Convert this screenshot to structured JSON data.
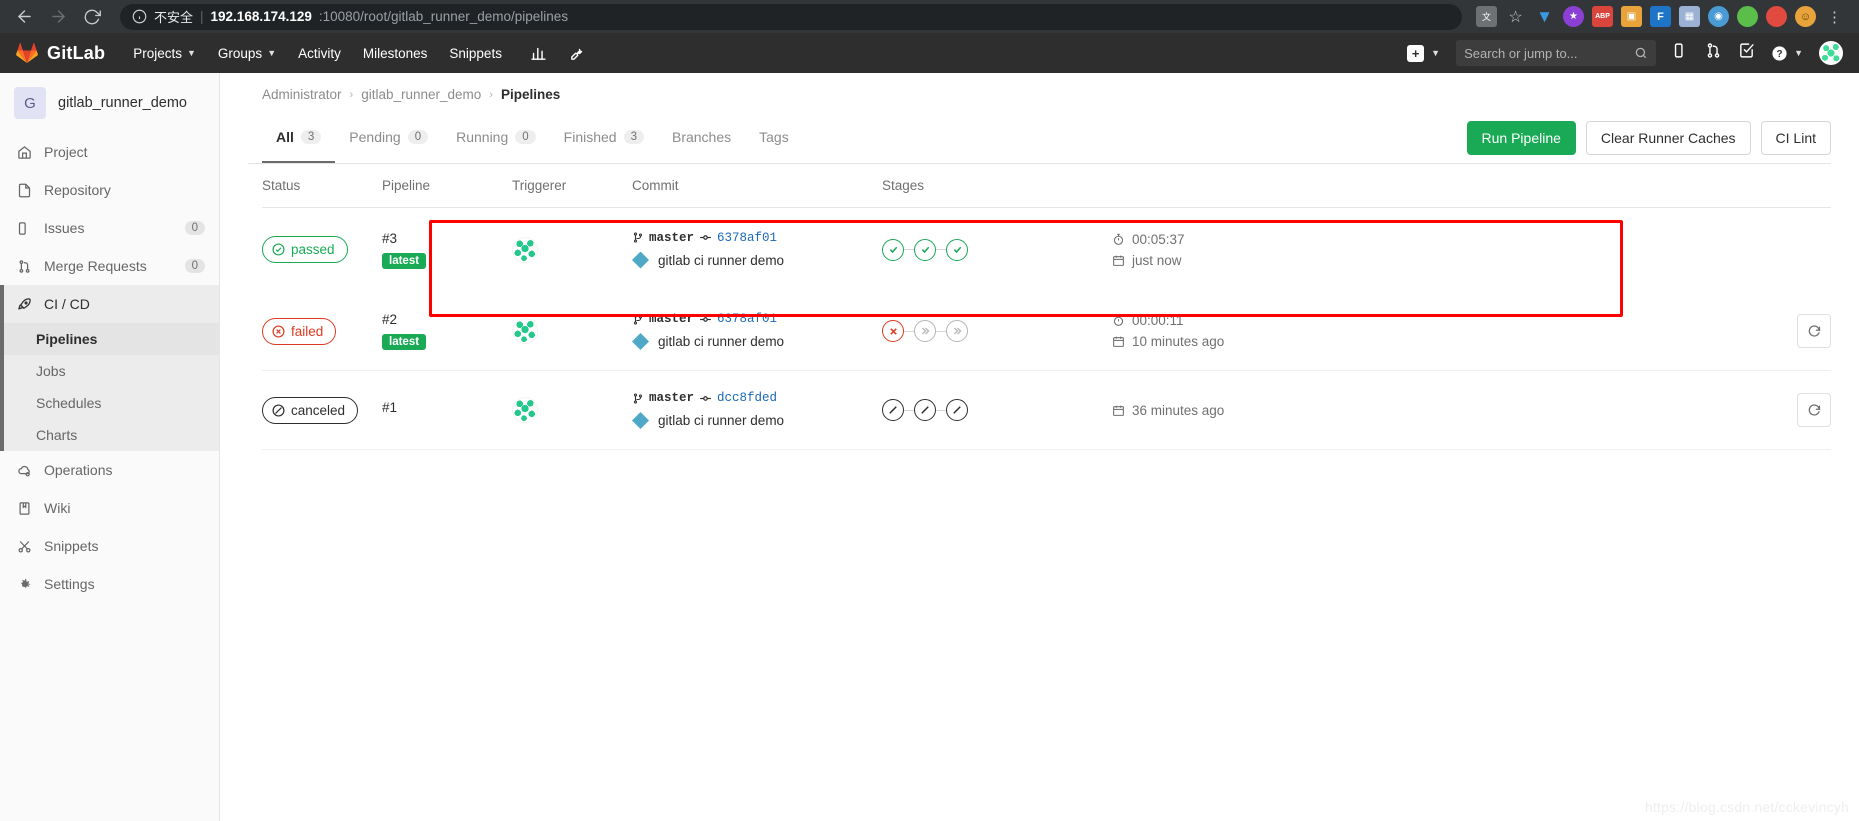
{
  "browser": {
    "back_icon": "back-arrow-icon",
    "forward_icon": "forward-arrow-icon",
    "reload_icon": "reload-icon",
    "security_label": "不安全",
    "url_host": "192.168.174.129",
    "url_rest": ":10080/root/gitlab_runner_demo/pipelines",
    "url_full": "192.168.174.129:10080/root/gitlab_runner_demo/pipelines",
    "toolbar_icons": [
      {
        "name": "translate-icon",
        "glyph": "文",
        "color": "#7a7d80"
      },
      {
        "name": "bookmark-star-icon",
        "glyph": "☆",
        "color": "transparent"
      },
      {
        "name": "shield-extension-icon",
        "glyph": "◆",
        "color": "#2a7fd4"
      },
      {
        "name": "purple-circle-extension-icon",
        "glyph": "★",
        "color": "#8b3fd4"
      },
      {
        "name": "adblock-icon",
        "glyph": "ABP",
        "color": "#d9453d"
      },
      {
        "name": "orange-extension-icon",
        "glyph": "▣",
        "color": "#e8743b"
      },
      {
        "name": "blue-extension-icon",
        "glyph": "F",
        "color": "#1e74c6"
      },
      {
        "name": "grid-extension-icon",
        "glyph": "▦",
        "color": "#9bb2d4"
      },
      {
        "name": "globe-extension-icon",
        "glyph": "◉",
        "color": "#4a9ad4"
      },
      {
        "name": "green-extension-icon",
        "glyph": "●",
        "color": "#5bbd4a"
      },
      {
        "name": "red-extension-icon",
        "glyph": "●",
        "color": "#e04a3f"
      },
      {
        "name": "smiley-extension-icon",
        "glyph": "☺",
        "color": "#e8a33b"
      },
      {
        "name": "menu-icon",
        "glyph": "⋮",
        "color": "transparent"
      }
    ]
  },
  "topnav": {
    "brand": "GitLab",
    "menu": [
      {
        "label": "Projects",
        "has_caret": true
      },
      {
        "label": "Groups",
        "has_caret": true
      },
      {
        "label": "Activity",
        "has_caret": false
      },
      {
        "label": "Milestones",
        "has_caret": false
      },
      {
        "label": "Snippets",
        "has_caret": false
      }
    ],
    "right_icons": [
      {
        "name": "analytics-icon",
        "glyph": "▥"
      },
      {
        "name": "wrench-admin-icon",
        "glyph": "🔧"
      }
    ],
    "new_label": "+",
    "search_placeholder": "Search or jump to...",
    "actions": [
      {
        "name": "issues-icon",
        "glyph": "▯"
      },
      {
        "name": "merge-requests-icon",
        "glyph": "⑂"
      },
      {
        "name": "todos-icon",
        "glyph": "☑"
      },
      {
        "name": "help-icon",
        "glyph": "?"
      }
    ]
  },
  "sidebar": {
    "project_initial": "G",
    "project_name": "gitlab_runner_demo",
    "items": [
      {
        "label": "Project",
        "icon": "home-icon",
        "badge": null,
        "active": false
      },
      {
        "label": "Repository",
        "icon": "document-icon",
        "badge": null,
        "active": false
      },
      {
        "label": "Issues",
        "icon": "issues-icon",
        "badge": "0",
        "active": false
      },
      {
        "label": "Merge Requests",
        "icon": "merge-request-icon",
        "badge": "0",
        "active": false
      },
      {
        "label": "CI / CD",
        "icon": "rocket-icon",
        "badge": null,
        "active": true
      },
      {
        "label": "Operations",
        "icon": "cloud-gear-icon",
        "badge": null,
        "active": false
      },
      {
        "label": "Wiki",
        "icon": "book-icon",
        "badge": null,
        "active": false
      },
      {
        "label": "Snippets",
        "icon": "scissors-icon",
        "badge": null,
        "active": false
      },
      {
        "label": "Settings",
        "icon": "gear-icon",
        "badge": null,
        "active": false
      }
    ],
    "cicd_subitems": [
      {
        "label": "Pipelines",
        "current": true
      },
      {
        "label": "Jobs",
        "current": false
      },
      {
        "label": "Schedules",
        "current": false
      },
      {
        "label": "Charts",
        "current": false
      }
    ]
  },
  "breadcrumb": {
    "items": [
      "Administrator",
      "gitlab_runner_demo",
      "Pipelines"
    ],
    "separator": "›"
  },
  "tabs": [
    {
      "label": "All",
      "count": "3",
      "active": true
    },
    {
      "label": "Pending",
      "count": "0",
      "active": false
    },
    {
      "label": "Running",
      "count": "0",
      "active": false
    },
    {
      "label": "Finished",
      "count": "3",
      "active": false
    },
    {
      "label": "Branches",
      "count": null,
      "active": false
    },
    {
      "label": "Tags",
      "count": null,
      "active": false
    }
  ],
  "actions": {
    "run_pipeline": "Run Pipeline",
    "clear_runner_caches": "Clear Runner Caches",
    "ci_lint": "CI Lint"
  },
  "table": {
    "headers": [
      "Status",
      "Pipeline",
      "Triggerer",
      "Commit",
      "Stages"
    ],
    "rows": [
      {
        "status": "passed",
        "status_kind": "passed",
        "status_icon": "check-circle-icon",
        "pipeline_id": "#3",
        "latest_badge": "latest",
        "triggerer_avatar": "user-avatar",
        "branch": "master",
        "sha": "6378af01",
        "commit_title": "gitlab ci runner demo",
        "stages": [
          "success",
          "success",
          "success"
        ],
        "duration": "00:05:37",
        "finished": "just now",
        "retry": false,
        "highlighted": true
      },
      {
        "status": "failed",
        "status_kind": "failed",
        "status_icon": "x-circle-icon",
        "pipeline_id": "#2",
        "latest_badge": "latest",
        "triggerer_avatar": "user-avatar",
        "branch": "master",
        "sha": "6378af01",
        "commit_title": "gitlab ci runner demo",
        "stages": [
          "fail",
          "skipped",
          "skipped"
        ],
        "duration": "00:00:11",
        "finished": "10 minutes ago",
        "retry": true,
        "highlighted": false
      },
      {
        "status": "canceled",
        "status_kind": "canceled",
        "status_icon": "cancel-circle-icon",
        "pipeline_id": "#1",
        "latest_badge": null,
        "triggerer_avatar": "user-avatar",
        "branch": "master",
        "sha": "dcc8fded",
        "commit_title": "gitlab ci runner demo",
        "stages": [
          "cancel",
          "cancel",
          "cancel"
        ],
        "duration": null,
        "finished": "36 minutes ago",
        "retry": true,
        "highlighted": false
      }
    ],
    "retry_icon": "retry-icon",
    "duration_icon": "stopwatch-icon",
    "date_icon": "calendar-icon"
  },
  "colors": {
    "accent_green": "#1aaa55",
    "fail_red": "#db3b21",
    "link_blue": "#1b69b6",
    "annotation_red": "#ff0000"
  },
  "watermark": "https://blog.csdn.net/cckevincyh"
}
